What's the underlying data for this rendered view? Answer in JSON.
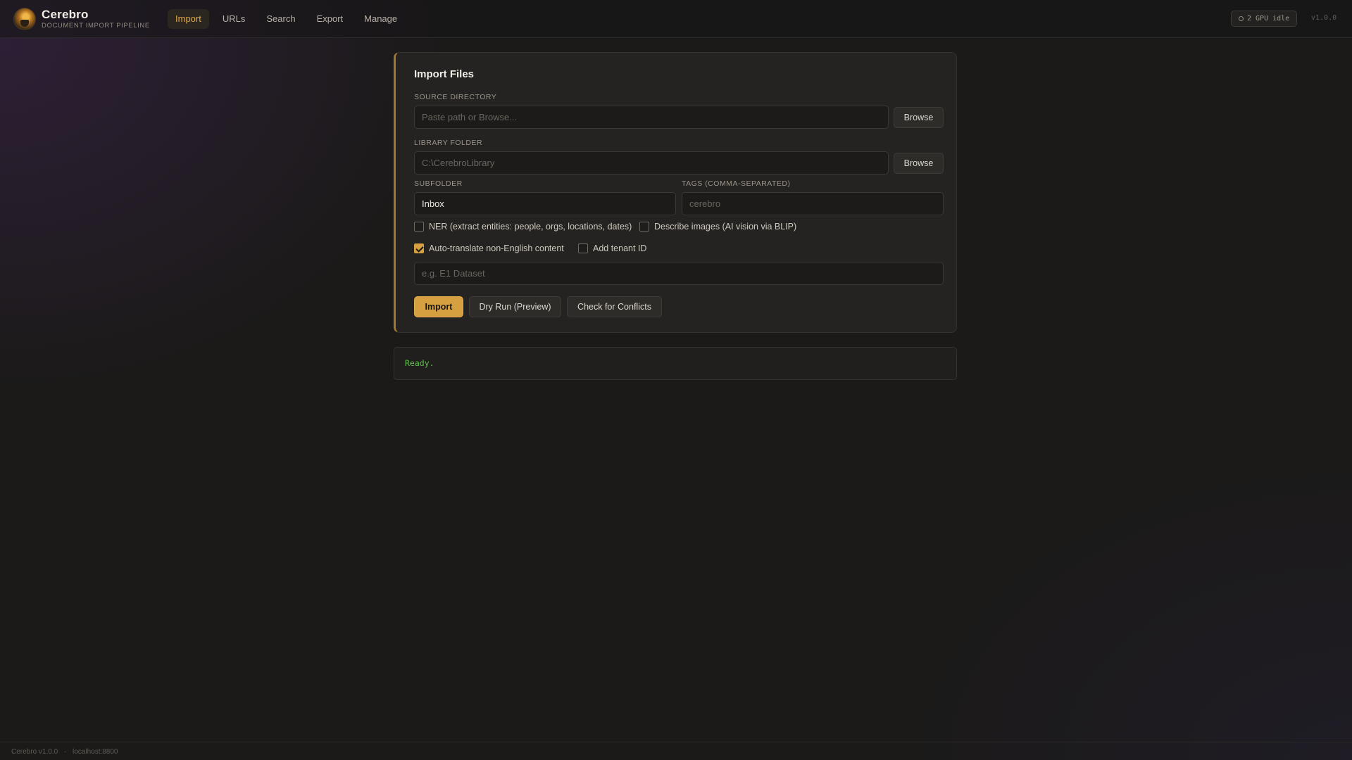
{
  "header": {
    "app_title": "Cerebro",
    "app_subtitle": "DOCUMENT IMPORT PIPELINE",
    "tabs": [
      {
        "label": "Import",
        "active": true
      },
      {
        "label": "URLs",
        "active": false
      },
      {
        "label": "Search",
        "active": false
      },
      {
        "label": "Export",
        "active": false
      },
      {
        "label": "Manage",
        "active": false
      }
    ],
    "gpu_status": "2 GPU idle",
    "version": "v1.0.0"
  },
  "import_card": {
    "title": "Import Files",
    "source_directory": {
      "label": "SOURCE DIRECTORY",
      "value": "",
      "placeholder": "Paste path or Browse...",
      "browse_label": "Browse"
    },
    "library_folder": {
      "label": "LIBRARY FOLDER",
      "value": "",
      "placeholder": "C:\\CerebroLibrary",
      "browse_label": "Browse"
    },
    "subfolder": {
      "label": "SUBFOLDER",
      "value": "Inbox",
      "placeholder": ""
    },
    "tags": {
      "label": "TAGS (COMMA-SEPARATED)",
      "value": "",
      "placeholder": "cerebro"
    },
    "options": {
      "ner": {
        "label": "NER (extract entities: people, orgs, locations, dates)",
        "checked": false
      },
      "describe_images": {
        "label": "Describe images (AI vision via BLIP)",
        "checked": false
      },
      "auto_translate": {
        "label": "Auto-translate non-English content",
        "checked": true
      },
      "tenant_id": {
        "label": "Add tenant ID",
        "checked": false
      }
    },
    "dataset": {
      "value": "",
      "placeholder": "e.g. E1 Dataset"
    },
    "actions": {
      "import_label": "Import",
      "dry_run_label": "Dry Run (Preview)",
      "conflicts_label": "Check for Conflicts"
    }
  },
  "log": {
    "text": "Ready."
  },
  "footer": {
    "app_version": "Cerebro v1.0.0",
    "separator": "·",
    "host": "localhost:8800"
  },
  "colors": {
    "accent": "#d6a040",
    "accent_text": "#e1a544",
    "log_text": "#5fc04a",
    "background": "#1b1a19",
    "card": "#242321"
  }
}
